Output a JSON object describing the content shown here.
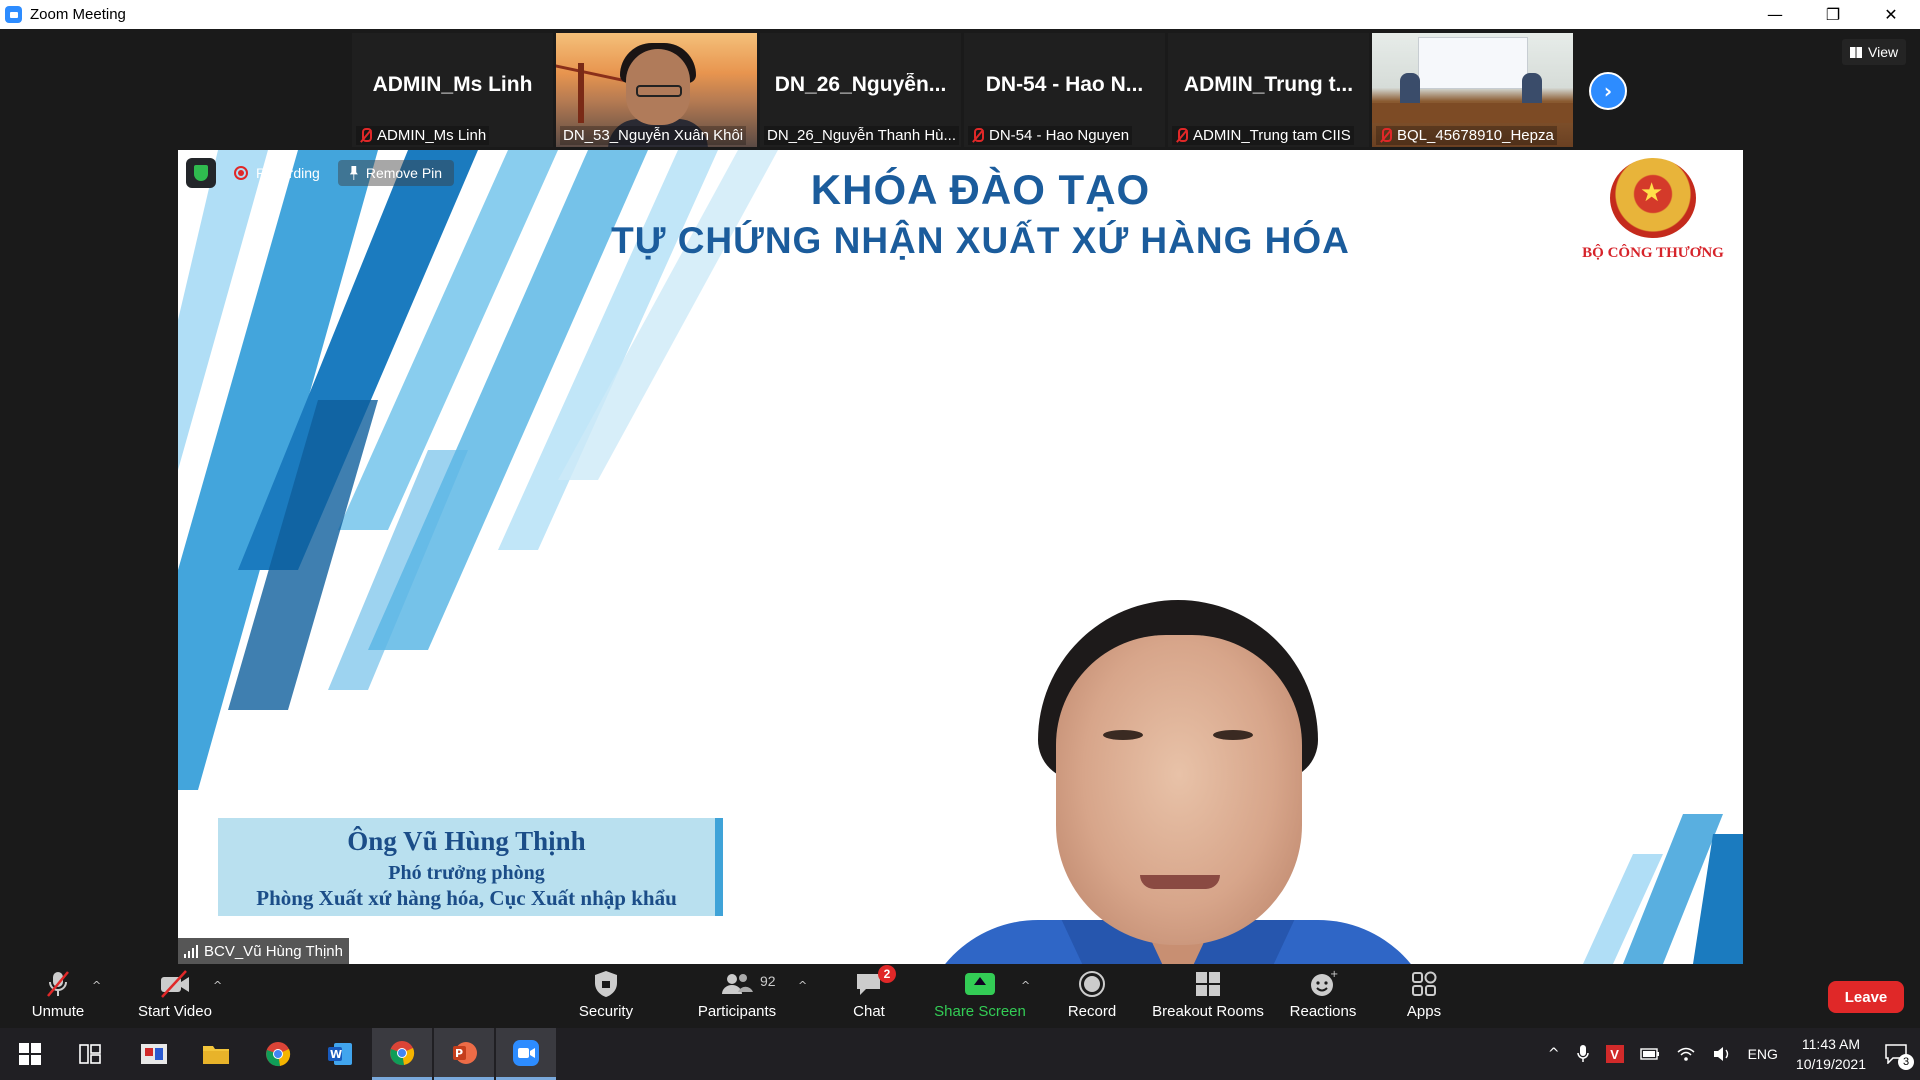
{
  "window": {
    "title": "Zoom Meeting",
    "controls": [
      "—",
      "❐",
      "✕"
    ]
  },
  "gallery": {
    "tiles": [
      {
        "big_name": "ADMIN_Ms Linh",
        "name": "ADMIN_Ms Linh",
        "muted": true
      },
      {
        "big_name": "",
        "name": "DN_53_Nguyễn Xuân Khôi",
        "muted": false,
        "has_video": true
      },
      {
        "big_name": "DN_26_Nguyễn...",
        "name": "DN_26_Nguyễn Thanh Hù...",
        "muted": false
      },
      {
        "big_name": "DN-54 - Hao N...",
        "name": "DN-54 - Hao Nguyen",
        "muted": true
      },
      {
        "big_name": "ADMIN_Trung t...",
        "name": "ADMIN_Trung tam CIIS",
        "muted": true
      },
      {
        "big_name": "",
        "name": "BQL_45678910_Hepza",
        "muted": true,
        "has_video": true
      }
    ],
    "next_icon": "chevron-right-icon",
    "view_label": "View"
  },
  "main": {
    "recording_label": "Recording",
    "remove_pin_label": "Remove Pin",
    "slide_title_1": "KHÓA ĐÀO TẠO",
    "slide_title_2": "TỰ CHỨNG NHẬN XUẤT XỨ HÀNG HÓA",
    "emblem_label": "BỘ CÔNG THƯƠNG",
    "name_card": {
      "name": "Ông Vũ Hùng Thịnh",
      "position": "Phó trưởng phòng",
      "department": "Phòng Xuất xứ hàng hóa, Cục Xuất nhập khẩu"
    },
    "speaker_label": "BCV_Vũ Hùng Thịnh"
  },
  "toolbar": {
    "unmute": "Unmute",
    "start_video": "Start Video",
    "security": "Security",
    "participants": "Participants",
    "participants_count": "92",
    "chat": "Chat",
    "chat_badge": "2",
    "share_screen": "Share Screen",
    "record": "Record",
    "breakout_rooms": "Breakout Rooms",
    "reactions": "Reactions",
    "apps": "Apps",
    "leave": "Leave"
  },
  "taskbar": {
    "language": "ENG",
    "time": "11:43 AM",
    "date": "10/19/2021",
    "notification_count": "3"
  },
  "colors": {
    "zoom_blue": "#2d8cff",
    "leave_red": "#e02828",
    "share_green": "#33cc55",
    "slide_title_blue": "#1b5c9c"
  }
}
